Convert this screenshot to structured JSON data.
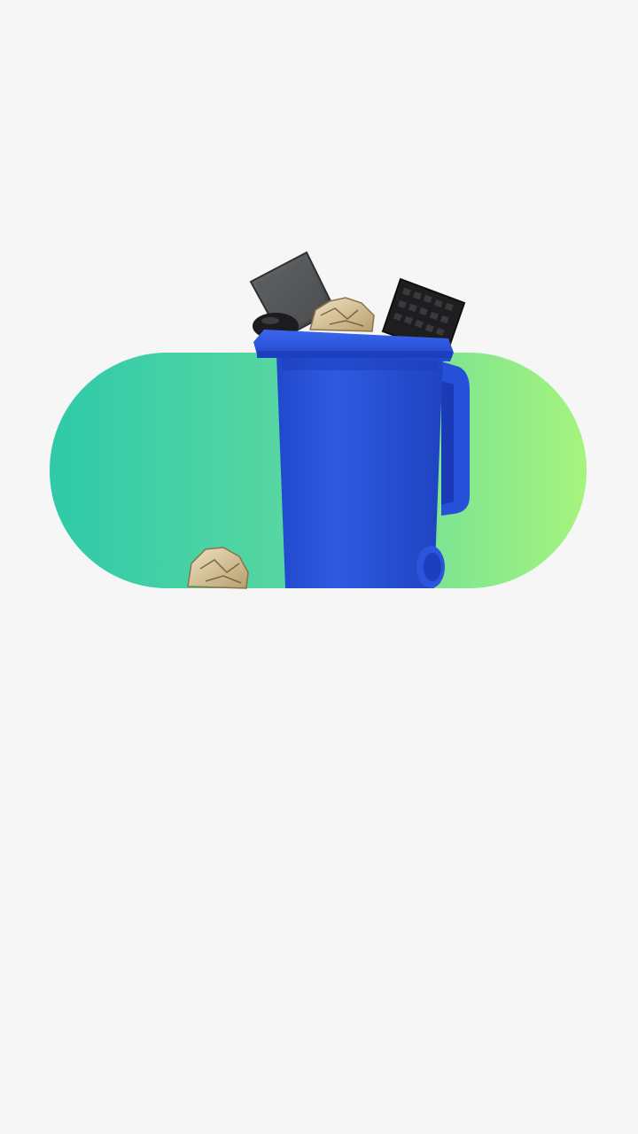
{
  "screen": {
    "background_color": "#f6f6f6"
  },
  "hero": {
    "pill_gradient_start": "#2fcaa9",
    "pill_gradient_end": "#a6f47d",
    "bin_color": "#2d56d8",
    "bin_dark_color": "#1d3fc0",
    "contents_icons": [
      "laptop-icon",
      "mouse-icon",
      "keyboard-icon",
      "crumpled-paper-icon"
    ],
    "floor_item_icon": "crumpled-paper-icon"
  }
}
